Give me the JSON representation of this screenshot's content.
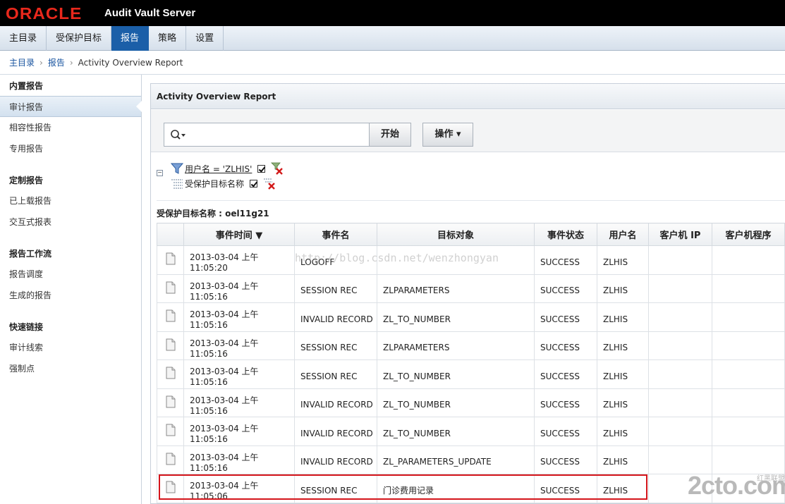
{
  "header": {
    "logo": "ORACLE",
    "app_name": "Audit Vault Server"
  },
  "nav": {
    "tabs": [
      "主目录",
      "受保护目标",
      "报告",
      "策略",
      "设置"
    ],
    "active": "报告"
  },
  "breadcrumb": {
    "home": "主目录",
    "reports": "报告",
    "current": "Activity Overview Report"
  },
  "sidebar": {
    "sections": [
      {
        "title": "内置报告",
        "items": [
          "审计报告",
          "相容性报告",
          "专用报告"
        ]
      },
      {
        "title": "定制报告",
        "items": [
          "已上载报告",
          "交互式报表"
        ]
      },
      {
        "title": "报告工作流",
        "items": [
          "报告调度",
          "生成的报告"
        ]
      },
      {
        "title": "快速链接",
        "items": [
          "审计线索",
          "强制点"
        ]
      }
    ],
    "selected": "审计报告"
  },
  "panel": {
    "title": "Activity Overview Report",
    "search_value": "",
    "go_label": "开始",
    "actions_label": "操作 ▾",
    "filters": [
      {
        "label": "用户名 = 'ZLHIS'",
        "checked": true
      },
      {
        "label": "受保护目标名称",
        "checked": true
      }
    ],
    "group_label": "受保护目标名称 : oel11g21"
  },
  "table": {
    "columns": [
      "",
      "事件时间 ▼",
      "事件名",
      "目标对象",
      "事件状态",
      "用户名",
      "客户机 IP",
      "客户机程序"
    ],
    "rows": [
      [
        "2013-03-04 上午 11:05:20",
        "LOGOFF",
        "",
        "SUCCESS",
        "ZLHIS",
        "",
        ""
      ],
      [
        "2013-03-04 上午 11:05:16",
        "SESSION REC",
        "ZLPARAMETERS",
        "SUCCESS",
        "ZLHIS",
        "",
        ""
      ],
      [
        "2013-03-04 上午 11:05:16",
        "INVALID RECORD",
        "ZL_TO_NUMBER",
        "SUCCESS",
        "ZLHIS",
        "",
        ""
      ],
      [
        "2013-03-04 上午 11:05:16",
        "SESSION REC",
        "ZLPARAMETERS",
        "SUCCESS",
        "ZLHIS",
        "",
        ""
      ],
      [
        "2013-03-04 上午 11:05:16",
        "SESSION REC",
        "ZL_TO_NUMBER",
        "SUCCESS",
        "ZLHIS",
        "",
        ""
      ],
      [
        "2013-03-04 上午 11:05:16",
        "INVALID RECORD",
        "ZL_TO_NUMBER",
        "SUCCESS",
        "ZLHIS",
        "",
        ""
      ],
      [
        "2013-03-04 上午 11:05:16",
        "INVALID RECORD",
        "ZL_TO_NUMBER",
        "SUCCESS",
        "ZLHIS",
        "",
        ""
      ],
      [
        "2013-03-04 上午 11:05:16",
        "INVALID RECORD",
        "ZL_PARAMETERS_UPDATE",
        "SUCCESS",
        "ZLHIS",
        "",
        ""
      ],
      [
        "2013-03-04 上午 11:05:06",
        "SESSION REC",
        "门诊费用记录",
        "SUCCESS",
        "ZLHIS",
        "",
        ""
      ]
    ]
  },
  "overlay": {
    "watermark": "http://blog.csdn.net/wenzhongyan",
    "brand_main": "2cto.com",
    "brand_sub": "红黑联盟"
  },
  "colors": {
    "nav_active": "#1b5fa8",
    "logo": "#e8281c",
    "highlight": "#d4151b",
    "link": "#1a55a0"
  }
}
